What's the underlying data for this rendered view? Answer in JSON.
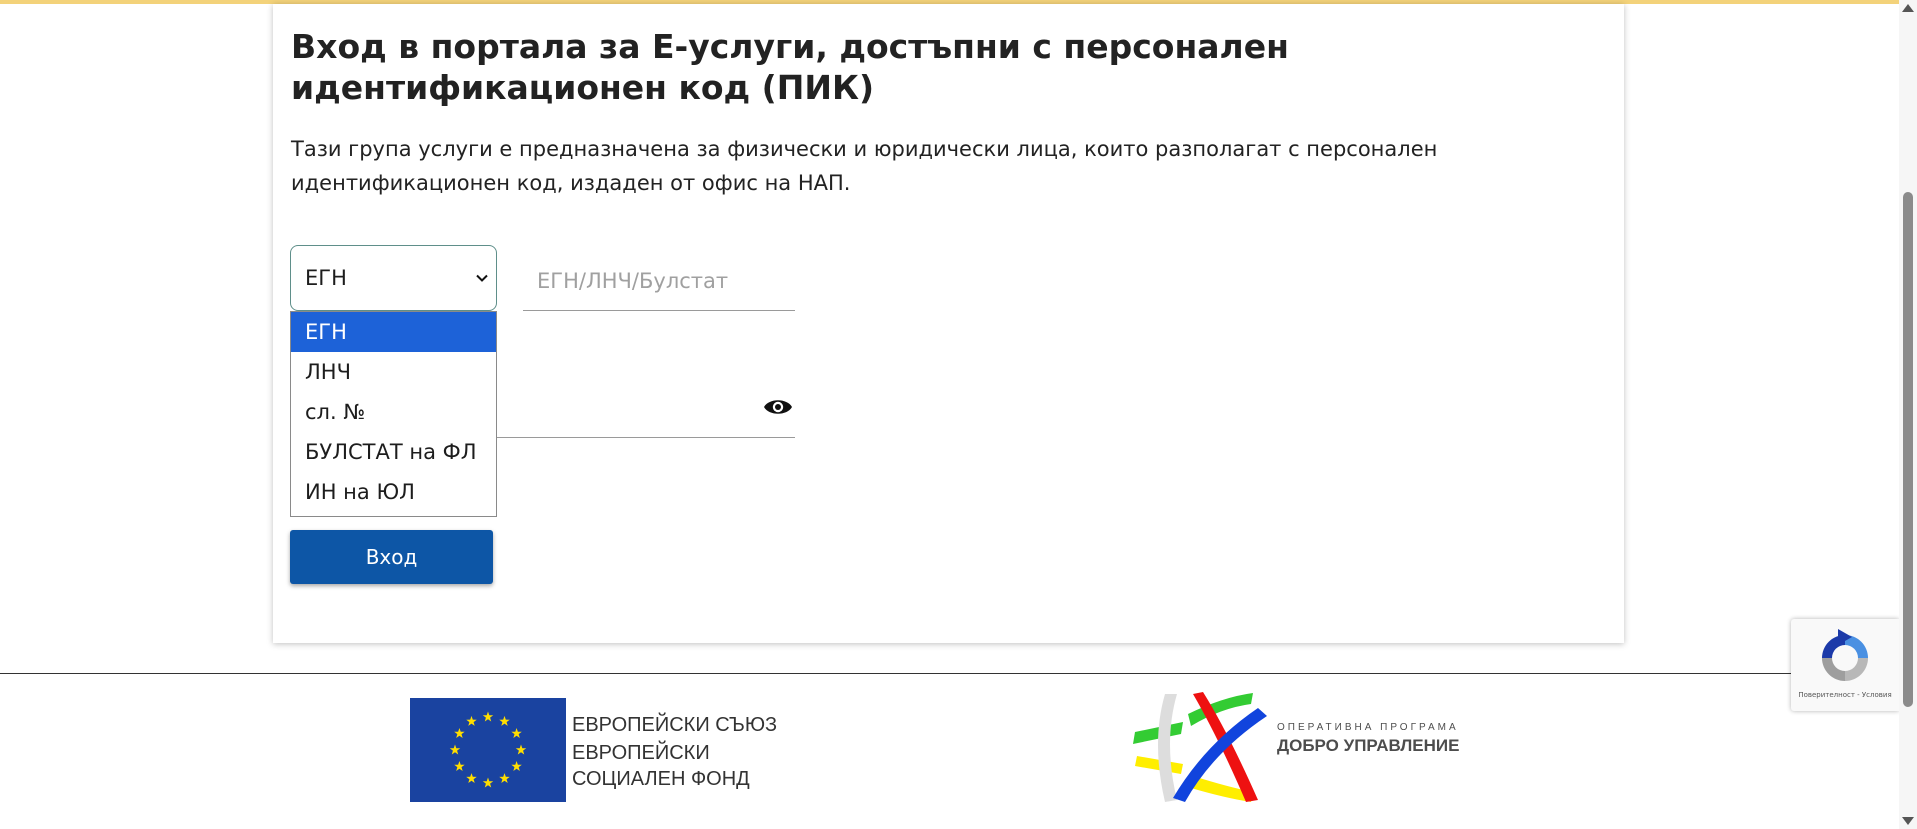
{
  "page": {
    "title": "Вход в портала за Е-услуги, достъпни с персонален идентификационен код (ПИК)",
    "description": "Тази група услуги е предназначена за физически и юридически лица, които разполагат с персонален идентификационен код, издаден от офис на НАП."
  },
  "form": {
    "id_type_selected": "ЕГН",
    "id_type_options": [
      "ЕГН",
      "ЛНЧ",
      "сл. №",
      "БУЛСТАТ на ФЛ",
      "ИН на ЮЛ"
    ],
    "id_placeholder": "ЕГН/ЛНЧ/Булстат",
    "password_toggle_icon": "eye-icon",
    "login_label": "Вход"
  },
  "footer": {
    "eu_line1": "ЕВРОПЕЙСКИ СЪЮЗ",
    "eu_line2": "ЕВРОПЕЙСКИ",
    "eu_line3": "СОЦИАЛЕН ФОНД",
    "op_small": "ОПЕРАТИВНА ПРОГРАМА",
    "op_big": "ДОБРО УПРАВЛЕНИЕ"
  },
  "recaptcha": {
    "privacy_terms": "Поверителност - Условия"
  },
  "colors": {
    "accent_bar": "#f3d27a",
    "primary_button": "#0d56a6",
    "selected_option": "#1d62d8",
    "eu_blue": "#1a43a0",
    "eu_star": "#ffde00"
  }
}
